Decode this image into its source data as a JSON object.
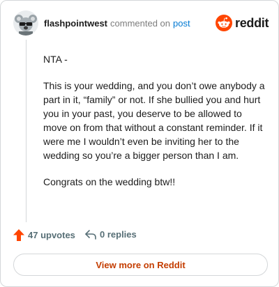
{
  "header": {
    "username": "flashpointwest",
    "action_text": "commented on",
    "post_link": "post",
    "brand_wordmark": "reddit"
  },
  "comment": {
    "paragraphs": [
      "NTA -",
      "This is your wedding, and you don’t owe anybody a part in it, “family” or not. If she bullied you and hurt you in your past, you deserve to be allowed to move on from that without a constant reminder. If it were me I wouldn’t even be inviting her to the wedding so you’re a bigger person than I am.",
      "Congrats on the wedding btw!!"
    ]
  },
  "actions": {
    "upvotes": "47 upvotes",
    "replies": "0 replies"
  },
  "footer": {
    "view_more": "View more on Reddit"
  },
  "colors": {
    "brand_orange": "#ff4500",
    "link_blue": "#0079d3",
    "view_more_text": "#c43d00",
    "muted": "#7c7c7c"
  },
  "icons": [
    "avatar-koala",
    "reddit-snoo-icon",
    "upvote-arrow-icon",
    "reply-icon"
  ]
}
